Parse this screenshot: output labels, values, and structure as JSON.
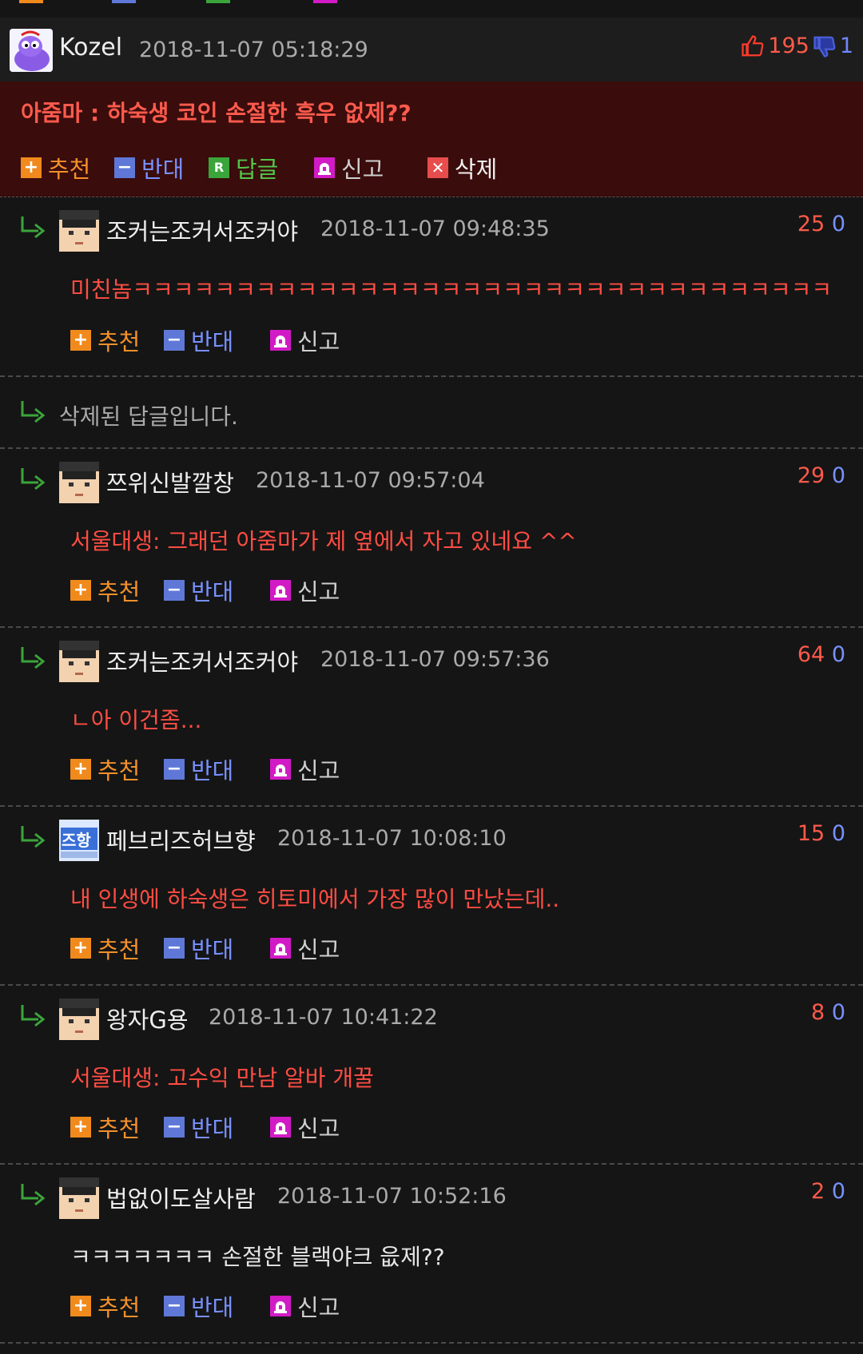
{
  "main_comment": {
    "author": "Kozel",
    "date": "2018-11-07 05:18:29",
    "up_votes": "195",
    "down_votes": "1",
    "title": "아줌마 : 하숙생 코인 손절한 흑우 없제??",
    "actions": {
      "recommend": "추천",
      "oppose": "반대",
      "reply": "답글",
      "report": "신고",
      "delete": "삭제"
    }
  },
  "action_labels": {
    "recommend": "추천",
    "oppose": "반대",
    "report": "신고"
  },
  "replies": [
    {
      "author": "조커는조커서조커야",
      "date": "2018-11-07 09:48:35",
      "up": "25",
      "down": "0",
      "text": "미친놈ㅋㅋㅋㅋㅋㅋㅋㅋㅋㅋㅋㅋㅋㅋㅋㅋㅋㅋㅋㅋㅋㅋㅋㅋㅋㅋㅋㅋㅋㅋㅋㅋㅋㅋ"
    },
    {
      "deleted_text": "삭제된 답글입니다."
    },
    {
      "author": "쯔위신발깔창",
      "date": "2018-11-07 09:57:04",
      "up": "29",
      "down": "0",
      "text": "서울대생: 그래던 아줌마가 제 옆에서 자고 있네요 ^^"
    },
    {
      "author": "조커는조커서조커야",
      "date": "2018-11-07 09:57:36",
      "up": "64",
      "down": "0",
      "text": "ㄴ아 이건좀..."
    },
    {
      "author": "페브리즈허브향",
      "date": "2018-11-07 10:08:10",
      "up": "15",
      "down": "0",
      "text": "내 인생에 하숙생은 히토미에서 가장 많이 만났는데..",
      "avatar_text": "즈항"
    },
    {
      "author": "왕자G용",
      "date": "2018-11-07 10:41:22",
      "up": "8",
      "down": "0",
      "text": "서울대생: 고수익 만남 알바 개꿀"
    },
    {
      "author": "법없이도살사람",
      "date": "2018-11-07 10:52:16",
      "up": "2",
      "down": "0",
      "text": "ㅋㅋㅋㅋㅋㅋㅋ 손절한 블랙야크 읎제??"
    }
  ],
  "colors": {
    "background": "#151515",
    "main_bg": "#3a0c0c",
    "up_red": "#ff5a4a",
    "down_blue": "#7891ff",
    "reply_text_red": "#ff4d43",
    "recommend_orange": "#f08a1d",
    "oppose_blue": "#5f78d8",
    "reply_green": "#3aa53a",
    "report_pink": "#d21bc6"
  }
}
